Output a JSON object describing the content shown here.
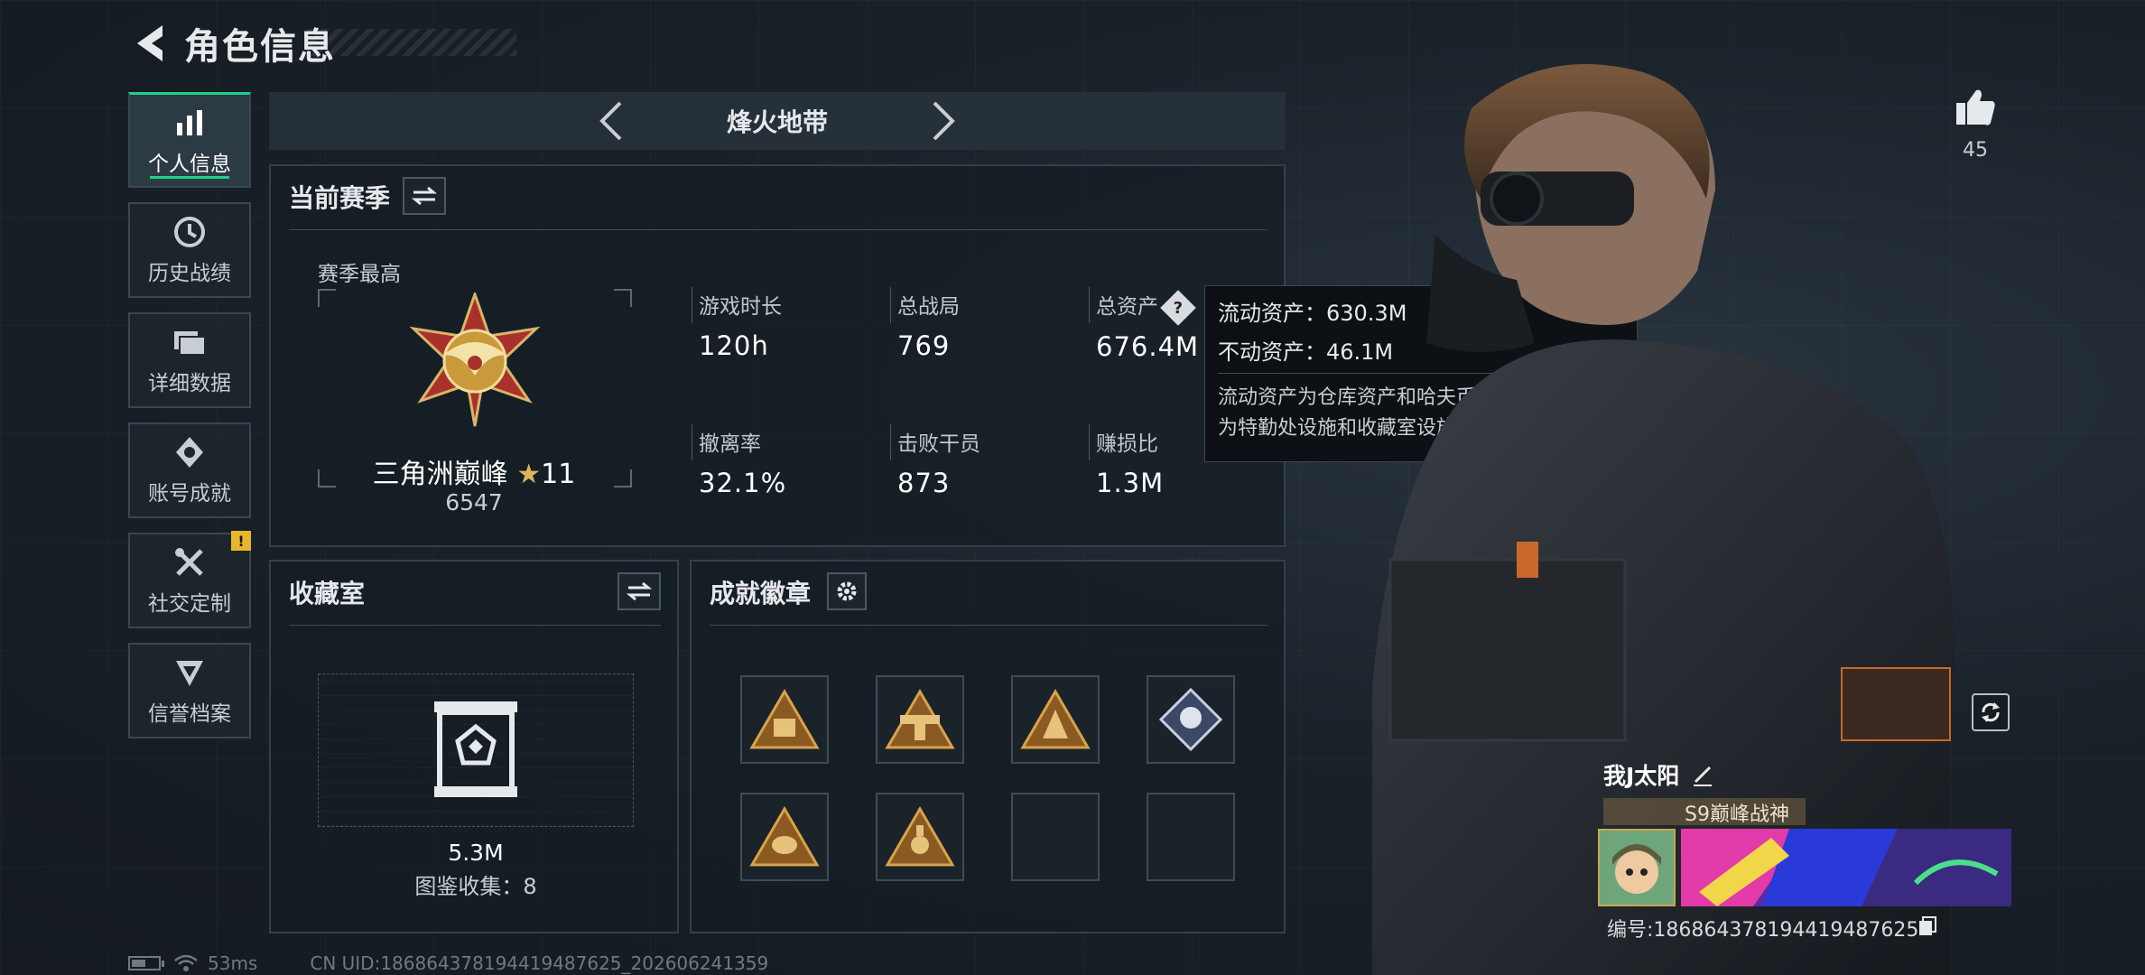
{
  "header": {
    "title": "角色信息"
  },
  "sidebar": {
    "items": [
      {
        "label": "个人信息",
        "icon": "bar-chart-icon",
        "active": true
      },
      {
        "label": "历史战绩",
        "icon": "history-icon"
      },
      {
        "label": "详细数据",
        "icon": "folder-icon"
      },
      {
        "label": "账号成就",
        "icon": "achievement-icon"
      },
      {
        "label": "社交定制",
        "icon": "tools-icon",
        "badge": "!"
      },
      {
        "label": "信誉档案",
        "icon": "reputation-icon"
      }
    ]
  },
  "mode": {
    "title": "烽火地带"
  },
  "season": {
    "title": "当前赛季",
    "best_label": "赛季最高",
    "rank_name": "三角洲巅峰",
    "rank_stars": "11",
    "rank_score": "6547",
    "stats": {
      "playtime": {
        "label": "游戏时长",
        "value": "120h"
      },
      "matches": {
        "label": "总战局",
        "value": "769"
      },
      "assets": {
        "label": "总资产",
        "value": "676.4M"
      },
      "extract_rate": {
        "label": "撤离率",
        "value": "32.1%"
      },
      "kills": {
        "label": "击败干员",
        "value": "873"
      },
      "profit_ratio": {
        "label": "赚损比",
        "value": "1.3M"
      }
    }
  },
  "tooltip": {
    "liquid": "流动资产：630.3M",
    "fixed": "不动资产：46.1M",
    "note_1": "流动资产为仓库资产和哈夫币，不动资产",
    "note_2": "为特勤处设施和收藏室设施"
  },
  "collection": {
    "title": "收藏室",
    "value": "5.3M",
    "count": "图鉴收集：8"
  },
  "badges": {
    "title": "成就徽章",
    "slots": [
      "badge-1",
      "badge-2",
      "badge-3",
      "badge-4",
      "badge-5",
      "badge-6",
      "",
      ""
    ]
  },
  "profile": {
    "likes": "45",
    "name": "我J太阳",
    "title": "S9巅峰战神",
    "id": "编号:186864378194419487625"
  },
  "status": {
    "ping": "53ms",
    "uid": "CN UID:186864378194419487625_202606241359",
    "battery_level": 0.55
  },
  "colors": {
    "accent": "#1ed18a",
    "badge_gold": "#c99a3b",
    "alert": "#e8b62b"
  }
}
